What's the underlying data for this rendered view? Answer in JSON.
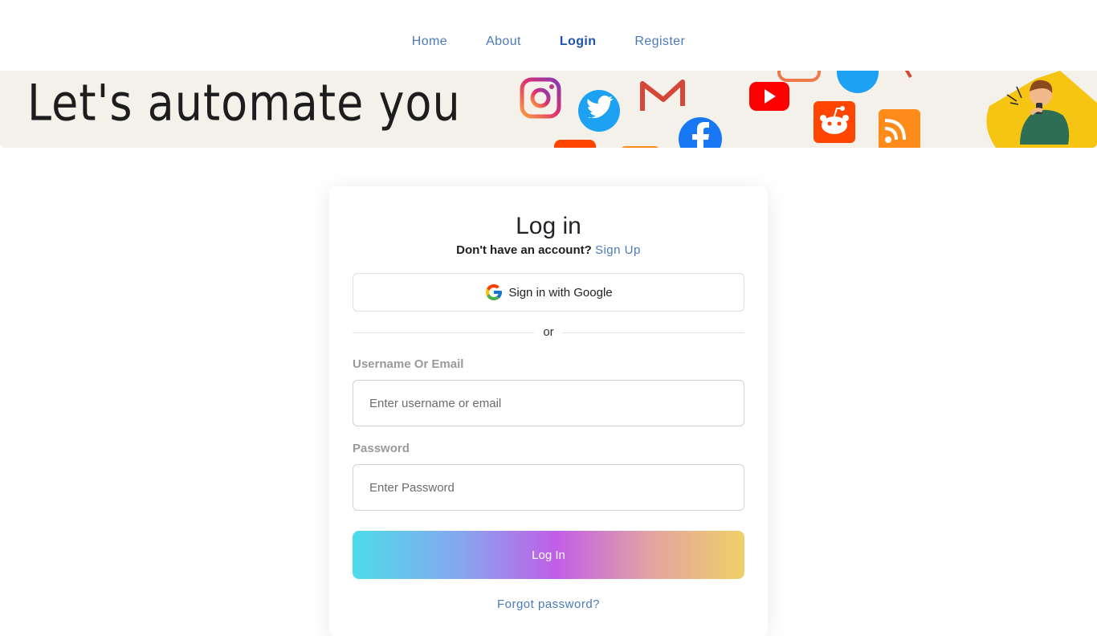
{
  "nav": {
    "items": [
      {
        "label": "Home",
        "active": false
      },
      {
        "label": "About",
        "active": false
      },
      {
        "label": "Login",
        "active": true
      },
      {
        "label": "Register",
        "active": false
      }
    ]
  },
  "banner": {
    "text": "Let's automate you",
    "icons": [
      "instagram-icon",
      "twitter-icon",
      "gmail-icon",
      "youtube-icon",
      "facebook-icon",
      "reddit-icon",
      "rss-icon"
    ]
  },
  "login": {
    "title": "Log in",
    "signup_prompt": "Don't have an account?",
    "signup_link": "Sign Up",
    "google_label": "Sign in with Google",
    "divider_text": "or",
    "username_label": "Username Or Email",
    "username_placeholder": "Enter username or email",
    "username_value": "",
    "password_label": "Password",
    "password_placeholder": "Enter Password",
    "password_value": "",
    "submit_label": "Log In",
    "forgot_label": "Forgot password?"
  },
  "colors": {
    "link": "#4a7ab8",
    "nav_active": "#1f55a8",
    "banner_bg": "#f4f1eb",
    "gradient": [
      "#4ddbe9",
      "#c15ee8",
      "#f0d067"
    ]
  }
}
